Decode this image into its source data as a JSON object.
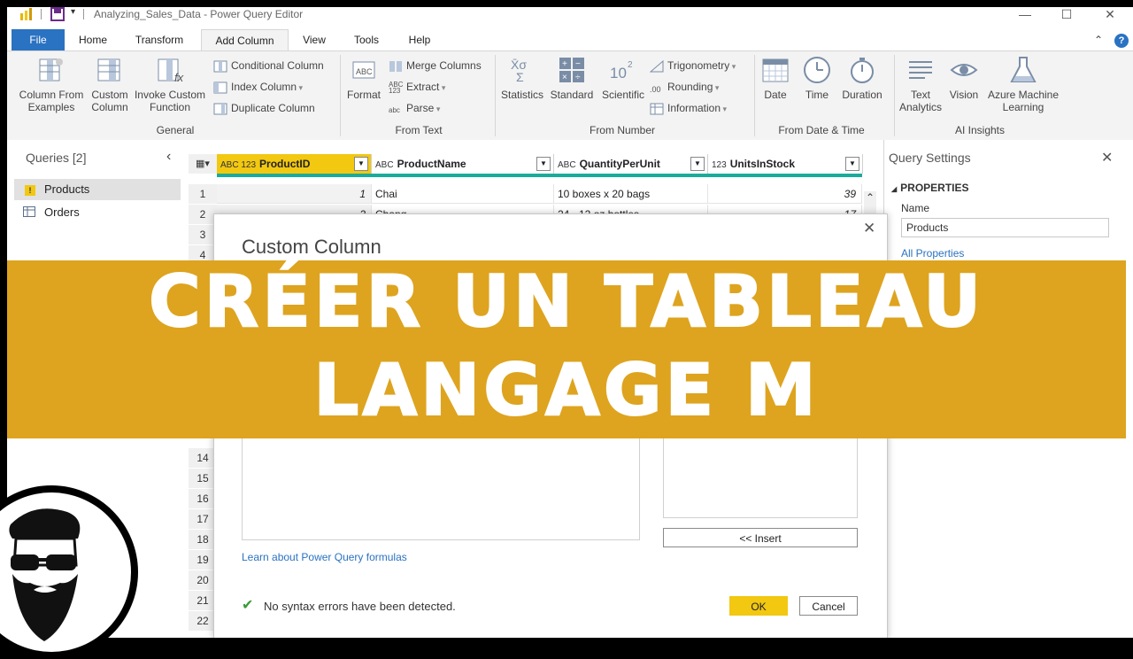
{
  "titlebar": {
    "title": "Analyzing_Sales_Data - Power Query Editor"
  },
  "tabs": [
    "File",
    "Home",
    "Transform",
    "Add Column",
    "View",
    "Tools",
    "Help"
  ],
  "ribbon": {
    "general": {
      "column_from_examples": "Column From Examples",
      "custom_column": "Custom Column",
      "invoke_custom_function": "Invoke Custom Function",
      "conditional_column": "Conditional Column",
      "index_column": "Index Column",
      "duplicate_column": "Duplicate Column",
      "label": "General"
    },
    "from_text": {
      "format": "Format",
      "merge_columns": "Merge Columns",
      "extract": "Extract",
      "parse": "Parse",
      "label": "From Text"
    },
    "from_number": {
      "statistics": "Statistics",
      "standard": "Standard",
      "scientific": "Scientific",
      "trigonometry": "Trigonometry",
      "rounding": "Rounding",
      "information": "Information",
      "label": "From Number"
    },
    "from_date_time": {
      "date": "Date",
      "time": "Time",
      "duration": "Duration",
      "label": "From Date & Time"
    },
    "ai_insights": {
      "text_analytics": "Text Analytics",
      "vision": "Vision",
      "azure_ml": "Azure Machine Learning",
      "label": "AI Insights"
    }
  },
  "queries": {
    "title": "Queries [2]",
    "items": [
      "Products",
      "Orders"
    ]
  },
  "grid": {
    "columns": [
      {
        "type": "ABC 123",
        "name": "ProductID"
      },
      {
        "type": "ABC",
        "name": "ProductName"
      },
      {
        "type": "ABC",
        "name": "QuantityPerUnit"
      },
      {
        "type": "123",
        "name": "UnitsInStock"
      }
    ],
    "rows": [
      {
        "n": "1",
        "id": "1",
        "name": "Chai",
        "qty": "10 boxes x 20 bags",
        "stock": "39"
      },
      {
        "n": "2",
        "id": "2",
        "name": "Chang",
        "qty": "24 - 12 oz bottles",
        "stock": "17"
      }
    ],
    "row_numbers": [
      "3",
      "4",
      "14",
      "15",
      "16",
      "17",
      "18",
      "19",
      "20",
      "21",
      "22"
    ]
  },
  "settings": {
    "title": "Query Settings",
    "properties": "PROPERTIES",
    "name_label": "Name",
    "name_value": "Products",
    "all_properties": "All Properties"
  },
  "dialog": {
    "title": "Custom Column",
    "insert": "<< Insert",
    "learn": "Learn about Power Query formulas",
    "status": "No syntax errors have been detected.",
    "ok": "OK",
    "cancel": "Cancel"
  },
  "banner": {
    "line1": "CRÉER UN TABLEAU",
    "line2": "LANGAGE M"
  },
  "colors": {
    "accent": "#dea41f",
    "file_tab": "#2a72c2",
    "header_highlight": "#f2c811",
    "teal": "#1aab9b",
    "link": "#2a72c2"
  }
}
